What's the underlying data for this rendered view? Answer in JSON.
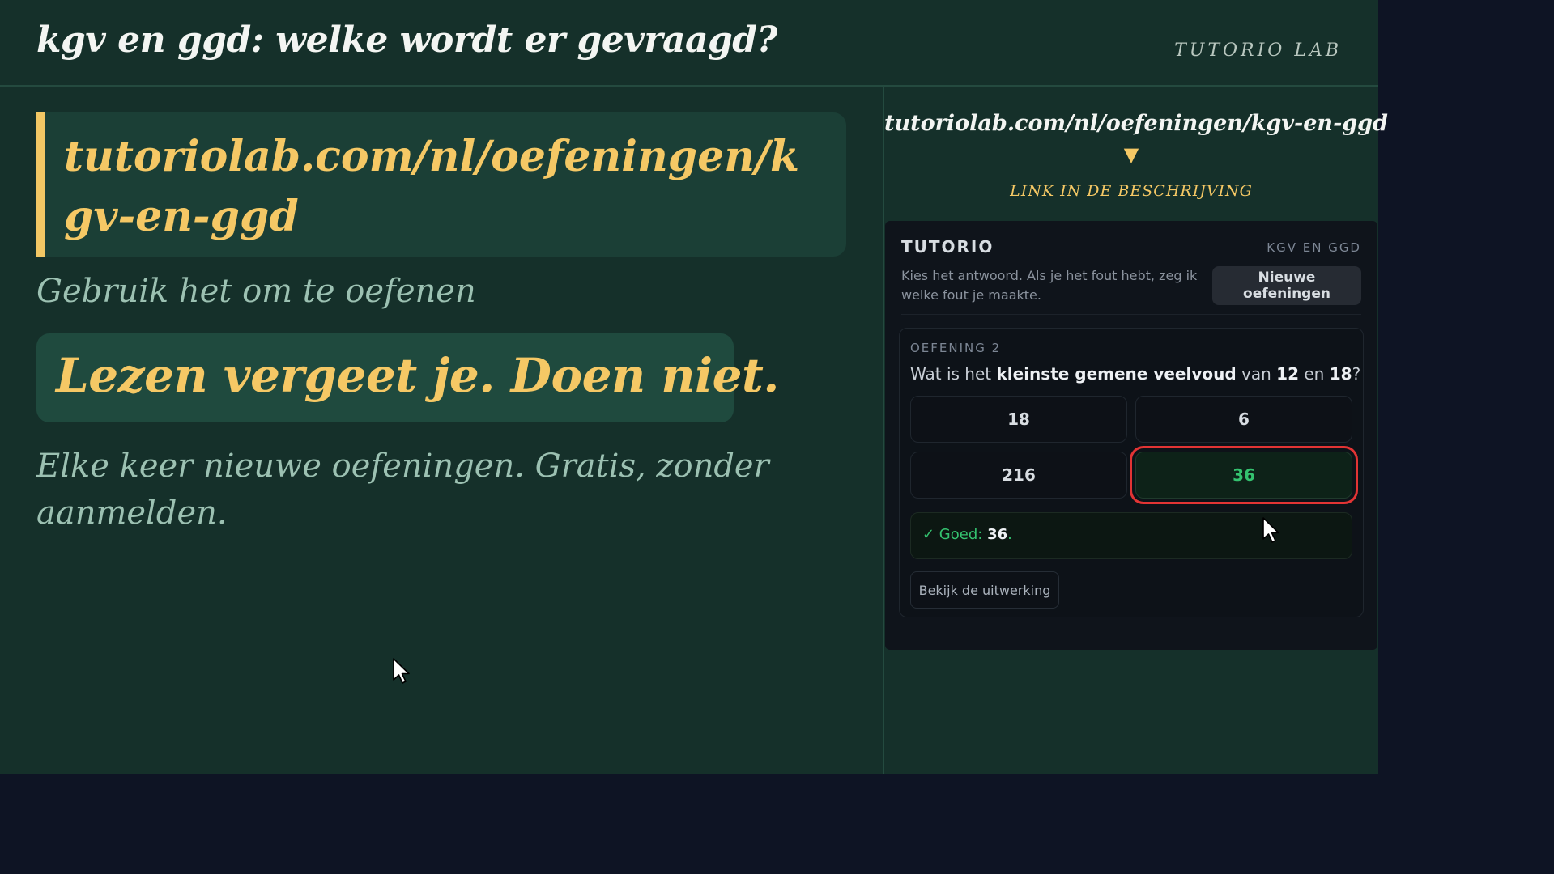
{
  "header": {
    "title": "kgv en ggd: welke wordt er gevraagd?",
    "brand": "TUTORIO LAB"
  },
  "left": {
    "url": "tutoriolab.com/nl/oefeningen/kgv-en-ggd",
    "subtitle": "Gebruik het om te oefenen",
    "slogan": "Lezen vergeet je. Doen niet.",
    "description": "Elke keer nieuwe oefeningen. Gratis, zonder aanmelden."
  },
  "right": {
    "url": "tutoriolab.com/nl/oefeningen/kgv-en-ggd",
    "arrow": "▼",
    "link_label": "LINK IN DE BESCHRIJVING"
  },
  "widget": {
    "brand": "TUTORIO",
    "topic": "KGV EN GGD",
    "hint": "Kies het antwoord. Als je het fout hebt, zeg ik welke fout je maakte.",
    "new_button": "Nieuwe oefeningen",
    "exercise": {
      "label": "OEFENING 2",
      "question_prefix": "Wat is het ",
      "question_term": "kleinste gemene veelvoud",
      "question_mid": " van ",
      "number_a": "12",
      "question_and": " en ",
      "number_b": "18",
      "question_suffix": "?",
      "options": [
        "18",
        "6",
        "216",
        "36"
      ],
      "selected": "36",
      "feedback_prefix": "✓ Goed: ",
      "feedback_value": "36",
      "feedback_suffix": ".",
      "explain_button": "Bekijk de uitwerking"
    }
  },
  "colors": {
    "stage_bg": "#15302a",
    "accent_yellow": "#f5c865",
    "correct_green": "#34c26f",
    "highlight_red": "#e23434"
  },
  "icons": {
    "cursor": "mouse-pointer-icon"
  }
}
